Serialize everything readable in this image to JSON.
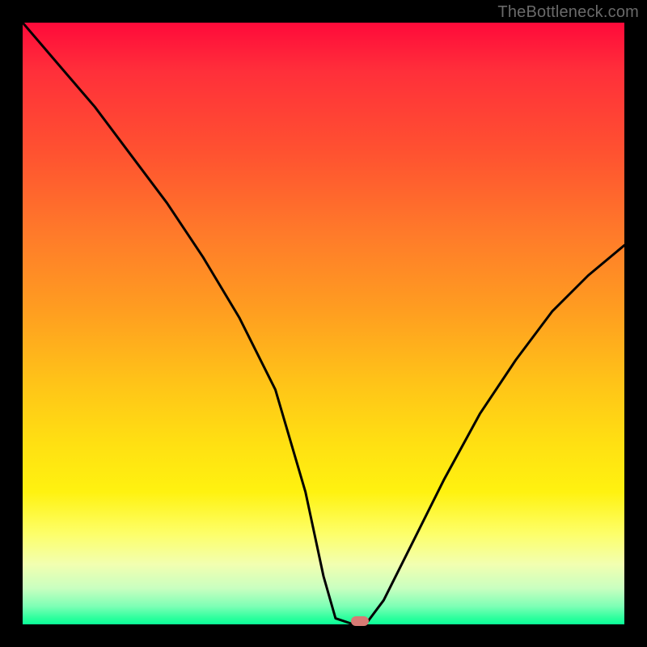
{
  "watermark": "TheBottleneck.com",
  "colors": {
    "frame": "#000000",
    "curve": "#000000",
    "marker": "#d77a74",
    "gradient_top": "#ff0a3a",
    "gradient_bottom": "#0aff98"
  },
  "chart_data": {
    "type": "line",
    "title": "",
    "xlabel": "",
    "ylabel": "",
    "xlim": [
      0,
      100
    ],
    "ylim": [
      0,
      100
    ],
    "grid": false,
    "legend": false,
    "notes": "V-shaped bottleneck curve over a vertical red→green gradient. Axes are unlabeled; x/y are normalized 0–100. Lower y = better (green).",
    "series": [
      {
        "name": "bottleneck-curve",
        "x": [
          0,
          6,
          12,
          18,
          24,
          30,
          36,
          42,
          47,
          50,
          52,
          55,
          57,
          60,
          64,
          70,
          76,
          82,
          88,
          94,
          100
        ],
        "values": [
          100,
          93,
          86,
          78,
          70,
          61,
          51,
          39,
          22,
          8,
          1,
          0,
          0,
          4,
          12,
          24,
          35,
          44,
          52,
          58,
          63
        ]
      }
    ],
    "marker": {
      "x": 56,
      "y": 0,
      "label": ""
    }
  }
}
